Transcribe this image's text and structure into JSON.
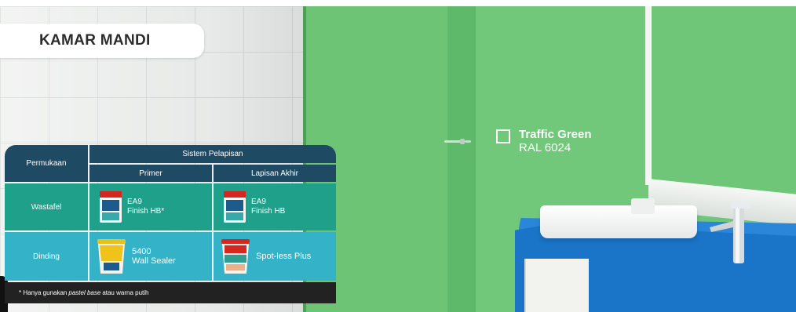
{
  "room_title": "KAMAR MANDI",
  "color": {
    "name": "Traffic Green",
    "code": "RAL 6024",
    "hex": "#6fc478"
  },
  "table": {
    "header_surface": "Permukaan",
    "header_system": "Sistem Pelapisan",
    "header_primer": "Primer",
    "header_finish": "Lapisan Akhir",
    "rows": [
      {
        "surface": "Wastafel",
        "primer": {
          "line1": "EA9",
          "line2": "Finish HB*"
        },
        "finish": {
          "line1": "EA9",
          "line2": "Finish HB"
        }
      },
      {
        "surface": "Dinding",
        "primer": {
          "line1": "5400",
          "line2": "Wall Sealer"
        },
        "finish": {
          "line1": "Spot-less Plus",
          "line2": ""
        }
      }
    ],
    "footnote_prefix": "* Hanya gunakan ",
    "footnote_italic": "pastel base",
    "footnote_suffix": " atau warna putih"
  },
  "colors": {
    "header": "#1f4a63",
    "row_wastafel": "#1fa08a",
    "row_dinding": "#33b2c8",
    "note_bar": "#222222",
    "counter": "#1a74c7"
  }
}
